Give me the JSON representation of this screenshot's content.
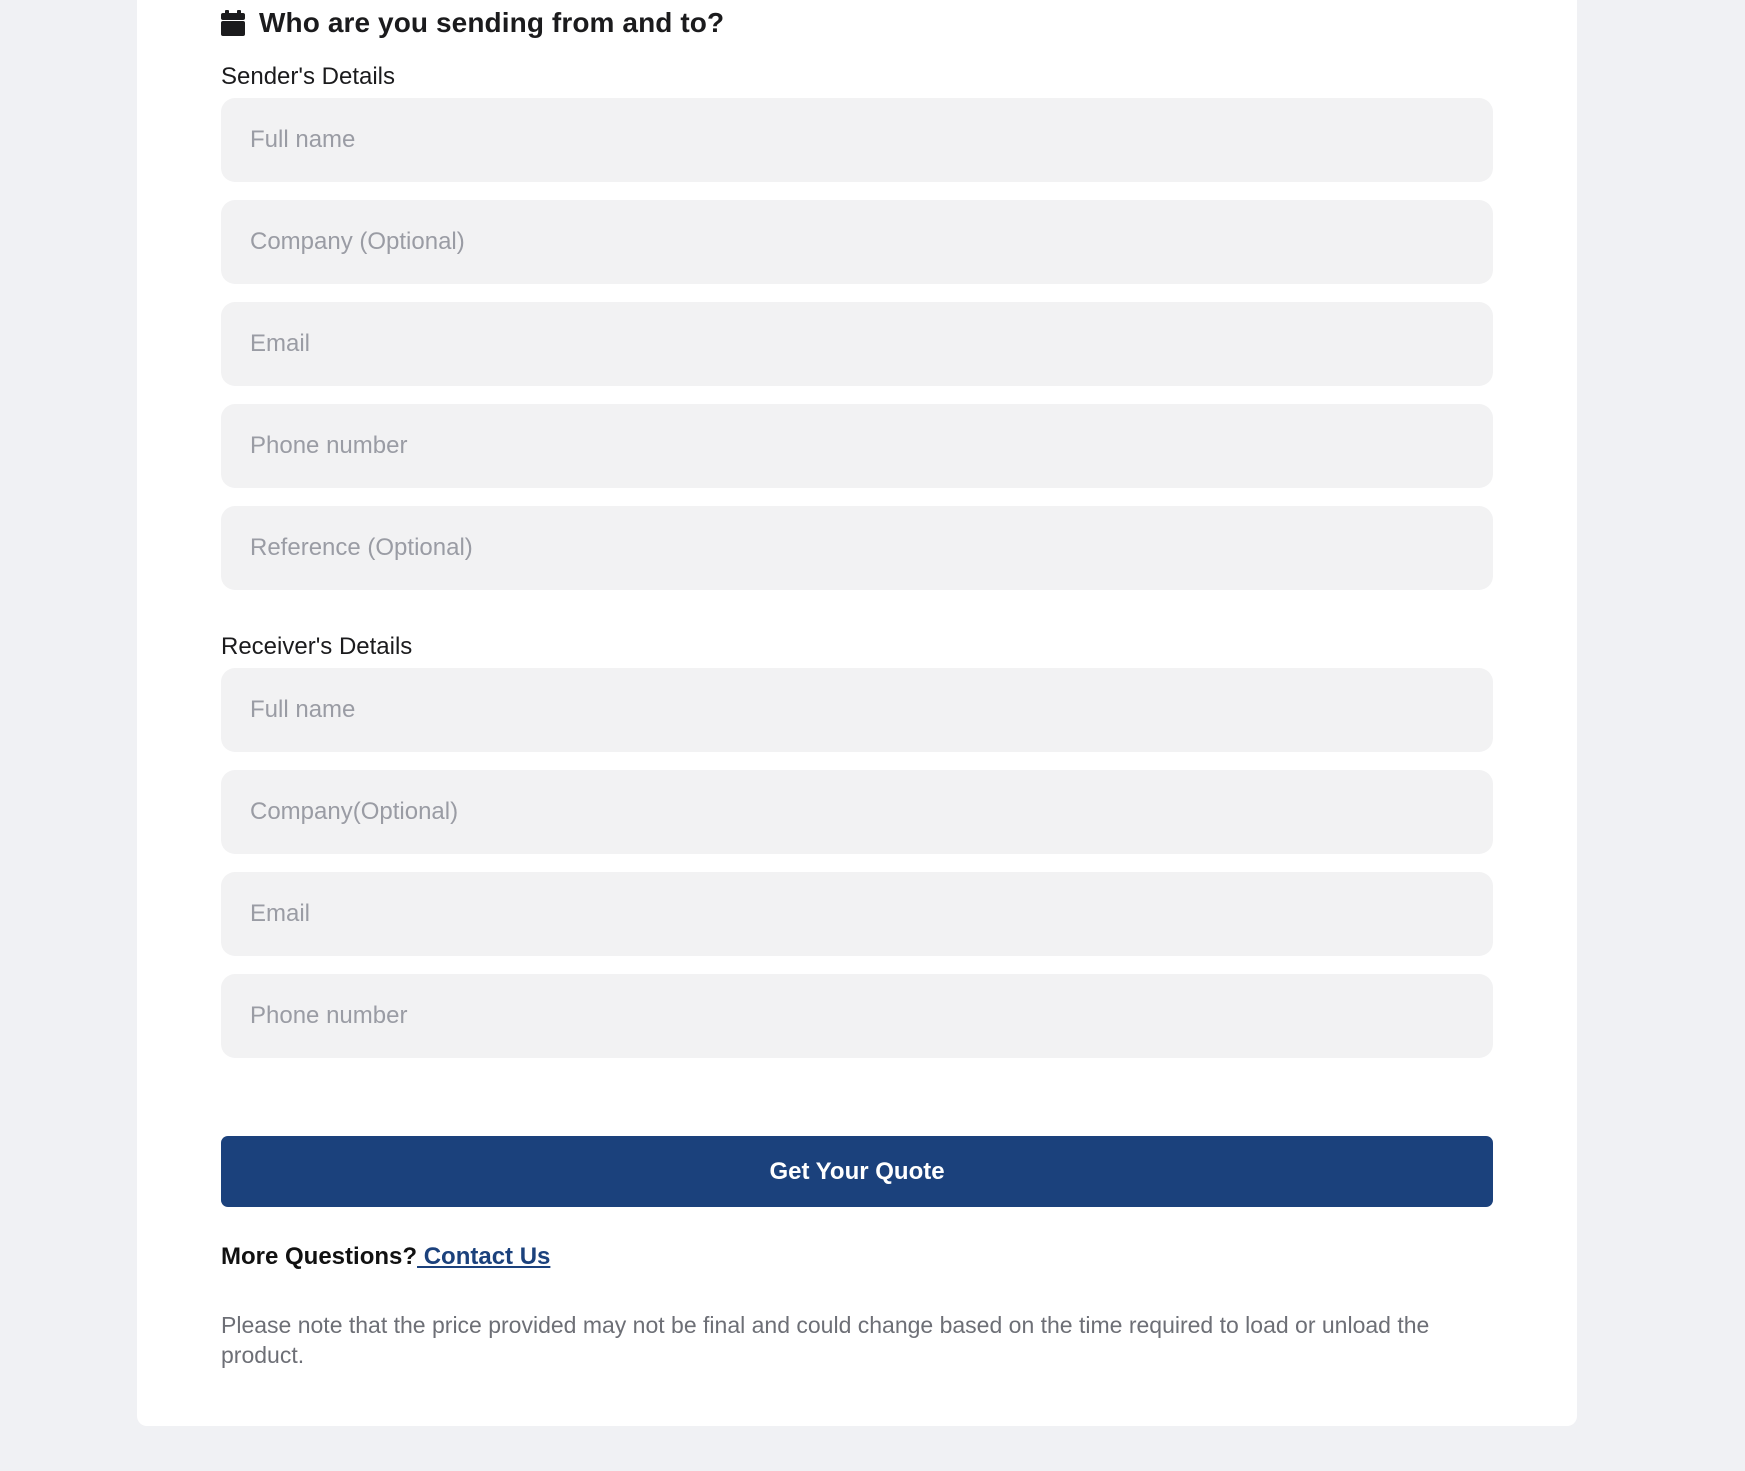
{
  "heading": {
    "icon": "calendar-icon",
    "title": "Who are you sending from and to?"
  },
  "sender": {
    "label": "Sender's Details",
    "fields": {
      "full_name": {
        "placeholder": "Full name",
        "value": ""
      },
      "company": {
        "placeholder": "Company (Optional)",
        "value": ""
      },
      "email": {
        "placeholder": "Email",
        "value": ""
      },
      "phone": {
        "placeholder": "Phone number",
        "value": ""
      },
      "reference": {
        "placeholder": "Reference (Optional)",
        "value": ""
      }
    }
  },
  "receiver": {
    "label": "Receiver's Details",
    "fields": {
      "full_name": {
        "placeholder": "Full name",
        "value": ""
      },
      "company": {
        "placeholder": "Company(Optional)",
        "value": ""
      },
      "email": {
        "placeholder": "Email",
        "value": ""
      },
      "phone": {
        "placeholder": "Phone number",
        "value": ""
      }
    }
  },
  "submit": {
    "label": "Get Your Quote"
  },
  "footer": {
    "question": "More Questions?",
    "contact_label": " Contact Us",
    "note": "Please note that the price provided may not be final and could change based on the time required to load or unload the product."
  },
  "colors": {
    "page_background": "#f0f1f4",
    "card_background": "#ffffff",
    "input_background": "#f2f2f3",
    "primary": "#1b417c",
    "placeholder_text": "#9a9ca4",
    "note_text": "#6d6f76"
  }
}
